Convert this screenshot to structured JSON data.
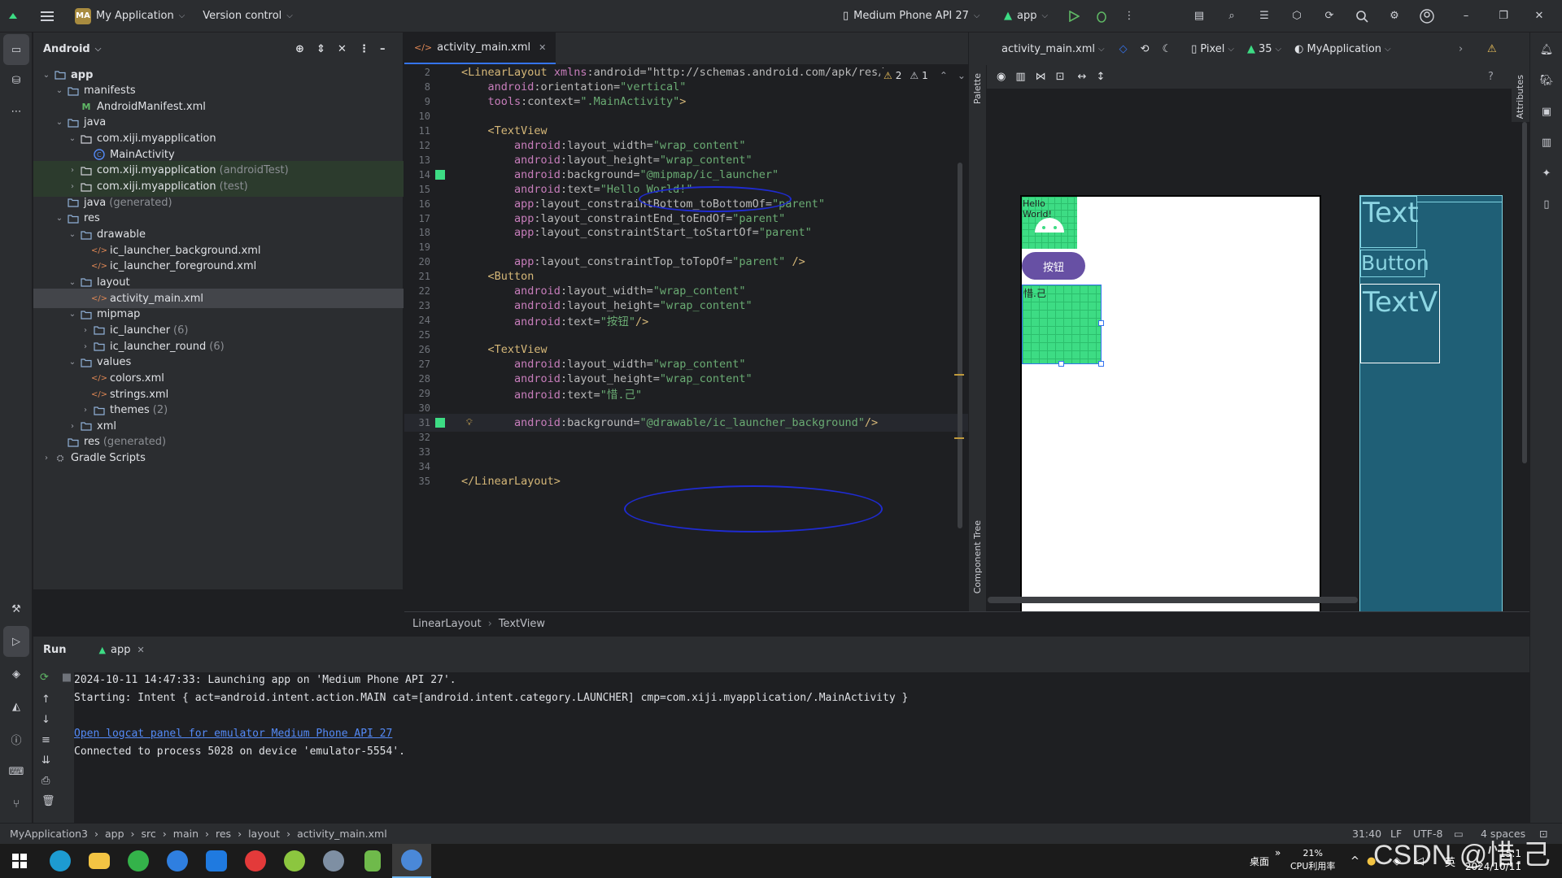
{
  "titlebar": {
    "project_badge": "MA",
    "project_name": "My Application",
    "vcs": "Version control",
    "device": "Medium Phone API 27",
    "run_config": "app"
  },
  "project_panel": {
    "title": "Android",
    "items": [
      {
        "label": "app",
        "suffix": "",
        "icon": "folder"
      },
      {
        "label": "manifests",
        "suffix": "",
        "icon": "folder"
      },
      {
        "label": "AndroidManifest.xml",
        "suffix": "",
        "icon": "manifest"
      },
      {
        "label": "java",
        "suffix": "",
        "icon": "folder"
      },
      {
        "label": "com.xiji.myapplication",
        "suffix": "",
        "icon": "package"
      },
      {
        "label": "MainActivity",
        "suffix": "",
        "icon": "class"
      },
      {
        "label": "com.xiji.myapplication",
        "suffix": "(androidTest)",
        "icon": "package"
      },
      {
        "label": "com.xiji.myapplication",
        "suffix": "(test)",
        "icon": "package"
      },
      {
        "label": "java",
        "suffix": "(generated)",
        "icon": "folder"
      },
      {
        "label": "res",
        "suffix": "",
        "icon": "folder"
      },
      {
        "label": "drawable",
        "suffix": "",
        "icon": "folder"
      },
      {
        "label": "ic_launcher_background.xml",
        "suffix": "",
        "icon": "xml"
      },
      {
        "label": "ic_launcher_foreground.xml",
        "suffix": "",
        "icon": "xml"
      },
      {
        "label": "layout",
        "suffix": "",
        "icon": "folder"
      },
      {
        "label": "activity_main.xml",
        "suffix": "",
        "icon": "xml"
      },
      {
        "label": "mipmap",
        "suffix": "",
        "icon": "folder"
      },
      {
        "label": "ic_launcher",
        "suffix": "(6)",
        "icon": "folder"
      },
      {
        "label": "ic_launcher_round",
        "suffix": "(6)",
        "icon": "folder"
      },
      {
        "label": "values",
        "suffix": "",
        "icon": "folder"
      },
      {
        "label": "colors.xml",
        "suffix": "",
        "icon": "xml"
      },
      {
        "label": "strings.xml",
        "suffix": "",
        "icon": "xml"
      },
      {
        "label": "themes",
        "suffix": "(2)",
        "icon": "folder"
      },
      {
        "label": "xml",
        "suffix": "",
        "icon": "folder"
      },
      {
        "label": "res",
        "suffix": "(generated)",
        "icon": "folder"
      },
      {
        "label": "Gradle Scripts",
        "suffix": "",
        "icon": "gradle"
      }
    ]
  },
  "editor": {
    "tab": "activity_main.xml",
    "warnings": "2",
    "weak_warnings": "1",
    "lines": [
      {
        "n": "2",
        "t": "<LinearLayout xmlns:android=\"http://schemas.android.com/apk/res/"
      },
      {
        "n": "8",
        "t": "    android:orientation=\"vertical\""
      },
      {
        "n": "9",
        "t": "    tools:context=\".MainActivity\">"
      },
      {
        "n": "10",
        "t": ""
      },
      {
        "n": "11",
        "t": "    <TextView"
      },
      {
        "n": "12",
        "t": "        android:layout_width=\"wrap_content\""
      },
      {
        "n": "13",
        "t": "        android:layout_height=\"wrap_content\""
      },
      {
        "n": "14",
        "t": "        android:background=\"@mipmap/ic_launcher\""
      },
      {
        "n": "15",
        "t": "        android:text=\"Hello World!\""
      },
      {
        "n": "16",
        "t": "        app:layout_constraintBottom_toBottomOf=\"parent\""
      },
      {
        "n": "17",
        "t": "        app:layout_constraintEnd_toEndOf=\"parent\""
      },
      {
        "n": "18",
        "t": "        app:layout_constraintStart_toStartOf=\"parent\""
      },
      {
        "n": "19",
        "t": ""
      },
      {
        "n": "20",
        "t": "        app:layout_constraintTop_toTopOf=\"parent\" />"
      },
      {
        "n": "21",
        "t": "    <Button"
      },
      {
        "n": "22",
        "t": "        android:layout_width=\"wrap_content\""
      },
      {
        "n": "23",
        "t": "        android:layout_height=\"wrap_content\""
      },
      {
        "n": "24",
        "t": "        android:text=\"按钮\"/>"
      },
      {
        "n": "25",
        "t": ""
      },
      {
        "n": "26",
        "t": "    <TextView"
      },
      {
        "n": "27",
        "t": "        android:layout_width=\"wrap_content\""
      },
      {
        "n": "28",
        "t": "        android:layout_height=\"wrap_content\""
      },
      {
        "n": "29",
        "t": "        android:text=\"惜.己\""
      },
      {
        "n": "30",
        "t": ""
      },
      {
        "n": "31",
        "t": "        android:background=\"@drawable/ic_launcher_background\"/>"
      },
      {
        "n": "32",
        "t": ""
      },
      {
        "n": "33",
        "t": ""
      },
      {
        "n": "34",
        "t": ""
      },
      {
        "n": "35",
        "t": "</LinearLayout>"
      }
    ]
  },
  "design": {
    "file": "activity_main.xml",
    "device": "Pixel",
    "api": "35",
    "theme": "MyApplication",
    "palette": "Palette",
    "component_tree": "Component Tree",
    "attributes": "Attributes",
    "preview_hello": "Hello World!",
    "preview_button": "按钮",
    "preview_text": "惜.己",
    "bp_text1": "Text",
    "bp_button": "Button",
    "bp_text2": "TextV"
  },
  "breadcrumb": {
    "a": "LinearLayout",
    "b": "TextView"
  },
  "run": {
    "title": "Run",
    "tab": "app",
    "lines": [
      "2024-10-11 14:47:33: Launching app on 'Medium Phone API 27'.",
      "Starting: Intent { act=android.intent.action.MAIN cat=[android.intent.category.LAUNCHER] cmp=com.xiji.myapplication/.MainActivity }",
      "",
      "Open logcat panel for emulator Medium Phone API 27",
      "Connected to process 5028 on device 'emulator-5554'."
    ]
  },
  "status": {
    "path": [
      "MyApplication3",
      "app",
      "src",
      "main",
      "res",
      "layout",
      "activity_main.xml"
    ],
    "position": "31:40",
    "line_sep": "LF",
    "encoding": "UTF-8",
    "indent": "4 spaces"
  },
  "taskbar": {
    "desktop": "桌面",
    "cpu_pct": "21%",
    "cpu_label": "CPU利用率",
    "ime": "英",
    "time": "15:1",
    "date": "2024/10/11",
    "watermark": "CSDN @惜.己"
  }
}
